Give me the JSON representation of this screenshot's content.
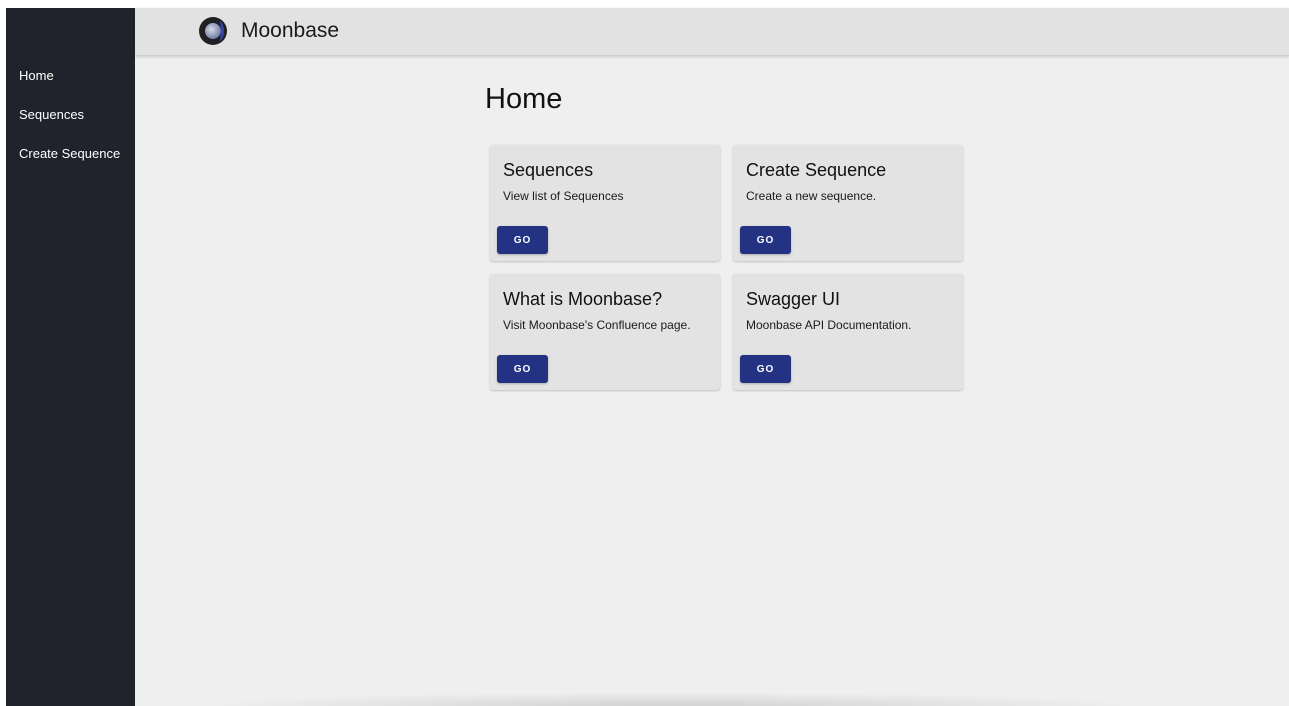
{
  "sidebar": {
    "items": [
      {
        "label": "Home"
      },
      {
        "label": "Sequences"
      },
      {
        "label": "Create Sequence"
      }
    ]
  },
  "header": {
    "brand_icon": "moon-logo-icon",
    "title": "Moonbase"
  },
  "main": {
    "page_title": "Home",
    "cards": [
      {
        "title": "Sequences",
        "description": "View list of Sequences",
        "button_label": "GO"
      },
      {
        "title": "Create Sequence",
        "description": "Create a new sequence.",
        "button_label": "GO"
      },
      {
        "title": "What is Moonbase?",
        "description": "Visit Moonbase's Confluence page.",
        "button_label": "GO"
      },
      {
        "title": "Swagger UI",
        "description": "Moonbase API Documentation.",
        "button_label": "GO"
      }
    ]
  },
  "colors": {
    "sidebar_bg": "#20232b",
    "topbar_bg": "#e2e2e2",
    "content_bg": "#efefef",
    "card_bg": "#e3e3e3",
    "button_bg": "#243283"
  }
}
